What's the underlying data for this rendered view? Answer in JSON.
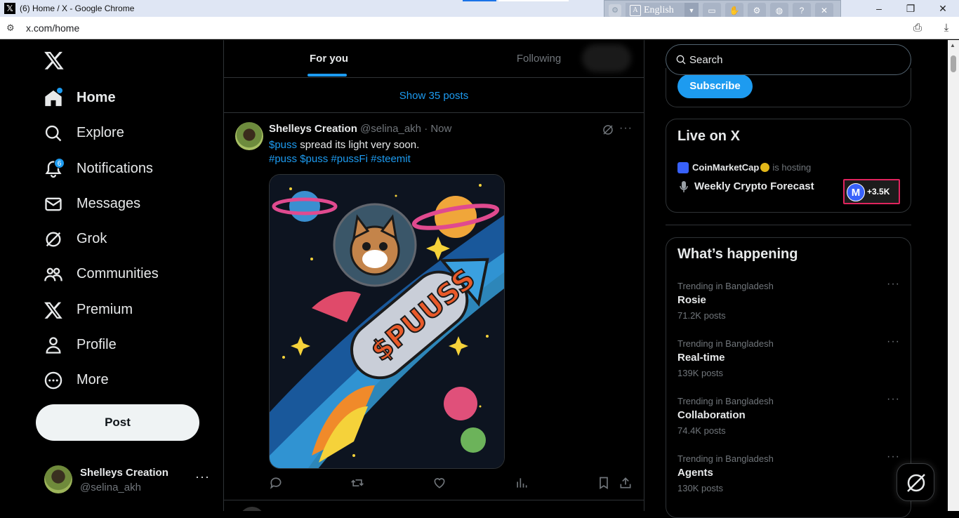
{
  "browser": {
    "window_title": "(6) Home / X - Google Chrome",
    "url": "x.com/home",
    "language_bar": {
      "language": "English"
    },
    "window_controls": {
      "minimize": "–",
      "restore": "❐",
      "close": "✕"
    }
  },
  "nav": {
    "logo": "X",
    "items": [
      {
        "label": "Home",
        "icon": "home-icon",
        "active": true,
        "dot": true
      },
      {
        "label": "Explore",
        "icon": "search-icon"
      },
      {
        "label": "Notifications",
        "icon": "bell-icon",
        "badge": "6"
      },
      {
        "label": "Messages",
        "icon": "mail-icon"
      },
      {
        "label": "Grok",
        "icon": "grok-icon"
      },
      {
        "label": "Communities",
        "icon": "people-icon"
      },
      {
        "label": "Premium",
        "icon": "x-logo-icon"
      },
      {
        "label": "Profile",
        "icon": "person-icon"
      },
      {
        "label": "More",
        "icon": "more-circle-icon"
      }
    ],
    "post_button": "Post",
    "account": {
      "name": "Shelleys Creation",
      "handle": "@selina_akh",
      "more": "···"
    }
  },
  "timeline": {
    "tabs": [
      {
        "label": "For you",
        "active": true
      },
      {
        "label": "Following"
      }
    ],
    "show_posts": "Show 35 posts",
    "tweet": {
      "author": "Shelleys Creation",
      "handle": "@selina_akh",
      "time": "· Now",
      "text_cashtag": "$puss",
      "text_rest": " spread its light very soon.",
      "tags": [
        "#puss",
        "$puss",
        "#pussFi",
        "#steemit"
      ],
      "image_text": "$PUUSS",
      "more": "···"
    }
  },
  "sidebar": {
    "search_placeholder": "Search",
    "subscribe": "Subscribe",
    "live": {
      "title": "Live on X",
      "host": "CoinMarketCap",
      "hosting": "is hosting",
      "show": "Weekly Crypto Forecast",
      "listeners": "+3.5K"
    },
    "happening": {
      "title": "What’s happening",
      "trends": [
        {
          "context": "Trending in Bangladesh",
          "name": "Rosie",
          "count": "71.2K posts"
        },
        {
          "context": "Trending in Bangladesh",
          "name": "Real-time",
          "count": "139K posts"
        },
        {
          "context": "Trending in Bangladesh",
          "name": "Collaboration",
          "count": "74.4K posts"
        },
        {
          "context": "Trending in Bangladesh",
          "name": "Agents",
          "count": "130K posts"
        }
      ],
      "more": "···"
    }
  },
  "colors": {
    "accent": "#1d9bf0",
    "background": "#000000",
    "border": "#2f3336",
    "muted": "#71767b"
  }
}
